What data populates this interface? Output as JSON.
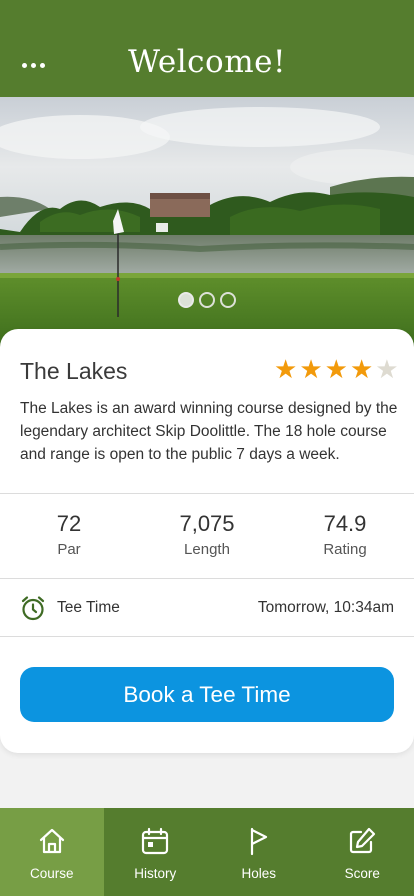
{
  "header": {
    "title": "Welcome!",
    "menu_icon": "more-dots-icon"
  },
  "carousel": {
    "slide_count": 3,
    "active_index": 0
  },
  "course": {
    "name": "The Lakes",
    "rating_stars": 4,
    "rating_max": 5,
    "description": "The Lakes is an award winning course designed by the legendary architect Skip Doolittle. The 18 hole course and range is open to the public 7 days a week."
  },
  "stats": [
    {
      "value": "72",
      "label": "Par"
    },
    {
      "value": "7,075",
      "label": "Length"
    },
    {
      "value": "74.9",
      "label": "Rating"
    }
  ],
  "tee_time": {
    "icon": "alarm-clock-icon",
    "label": "Tee Time",
    "value": "Tomorrow, 10:34am"
  },
  "book_button": {
    "label": "Book a Tee Time"
  },
  "tabs": [
    {
      "label": "Course",
      "icon": "home-icon",
      "active": true
    },
    {
      "label": "History",
      "icon": "calendar-icon",
      "active": false
    },
    {
      "label": "Holes",
      "icon": "flag-icon",
      "active": false
    },
    {
      "label": "Score",
      "icon": "edit-icon",
      "active": false
    }
  ],
  "colors": {
    "header_green": "#557d2e",
    "active_tab_green": "#779e45",
    "button_blue": "#0c94e0",
    "star_orange": "#f29a0b"
  }
}
